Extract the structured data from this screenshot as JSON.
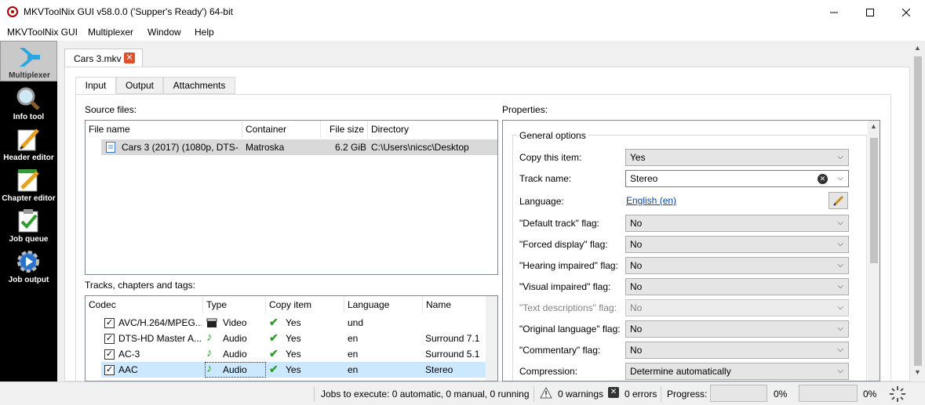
{
  "window": {
    "title": "MKVToolNix GUI v58.0.0 ('Supper's Ready') 64-bit"
  },
  "menu": [
    "MKVToolNix GUI",
    "Multiplexer",
    "Window",
    "Help"
  ],
  "sidebar": {
    "items": [
      {
        "label": "Multiplexer",
        "icon": "multiplexer-icon",
        "active": true
      },
      {
        "label": "Info tool",
        "icon": "info-tool-icon",
        "active": false
      },
      {
        "label": "Header editor",
        "icon": "header-editor-icon",
        "active": false
      },
      {
        "label": "Chapter editor",
        "icon": "chapter-editor-icon",
        "active": false
      },
      {
        "label": "Job queue",
        "icon": "job-queue-icon",
        "active": false
      },
      {
        "label": "Job output",
        "icon": "job-output-icon",
        "active": false
      }
    ]
  },
  "document_tab": {
    "label": "Cars 3.mkv"
  },
  "tabs": [
    "Input",
    "Output",
    "Attachments"
  ],
  "source_files": {
    "label": "Source files:",
    "columns": [
      "File name",
      "Container",
      "File size",
      "Directory"
    ],
    "rows": [
      {
        "file_name": "Cars 3 (2017) (1080p, DTS-...",
        "container": "Matroska",
        "file_size": "6.2 GiB",
        "directory": "C:\\Users\\nicsc\\Desktop"
      }
    ]
  },
  "tracks": {
    "label": "Tracks, chapters and tags:",
    "columns": [
      "Codec",
      "Type",
      "Copy item",
      "Language",
      "Name"
    ],
    "rows": [
      {
        "codec": "AVC/H.264/MPEG...",
        "type": "Video",
        "type_icon": "video-clapper-icon",
        "copy": "Yes",
        "language": "und",
        "name": ""
      },
      {
        "codec": "DTS-HD Master A...",
        "type": "Audio",
        "type_icon": "audio-note-icon",
        "copy": "Yes",
        "language": "en",
        "name": "Surround 7.1"
      },
      {
        "codec": "AC-3",
        "type": "Audio",
        "type_icon": "audio-note-icon",
        "copy": "Yes",
        "language": "en",
        "name": "Surround 5.1"
      },
      {
        "codec": "AAC",
        "type": "Audio",
        "type_icon": "audio-note-icon",
        "copy": "Yes",
        "language": "en",
        "name": "Stereo"
      }
    ]
  },
  "properties": {
    "label": "Properties:",
    "group": "General options",
    "fields": [
      {
        "label": "Copy this item:",
        "value": "Yes"
      },
      {
        "label": "Track name:",
        "value": "Stereo"
      },
      {
        "label": "Language:",
        "value": "English (en)"
      },
      {
        "label": "\"Default track\" flag:",
        "value": "No"
      },
      {
        "label": "\"Forced display\" flag:",
        "value": "No"
      },
      {
        "label": "\"Hearing impaired\" flag:",
        "value": "No"
      },
      {
        "label": "\"Visual impaired\" flag:",
        "value": "No"
      },
      {
        "label": "\"Text descriptions\" flag:",
        "value": "No"
      },
      {
        "label": "\"Original language\" flag:",
        "value": "No"
      },
      {
        "label": "\"Commentary\" flag:",
        "value": "No"
      },
      {
        "label": "Compression:",
        "value": "Determine automatically"
      }
    ]
  },
  "status": {
    "jobs": "Jobs to execute:  0 automatic, 0 manual, 0 running",
    "warnings": "0 warnings",
    "errors": "0 errors",
    "progress_label": "Progress:",
    "progress1": "0%",
    "progress2": "0%"
  },
  "colors": {
    "sidebar_bg": "#000000",
    "selection": "#cce8ff",
    "row_selected_gray": "#d9d9d9",
    "link": "#0645ad",
    "check_green": "#2e9e2e"
  }
}
